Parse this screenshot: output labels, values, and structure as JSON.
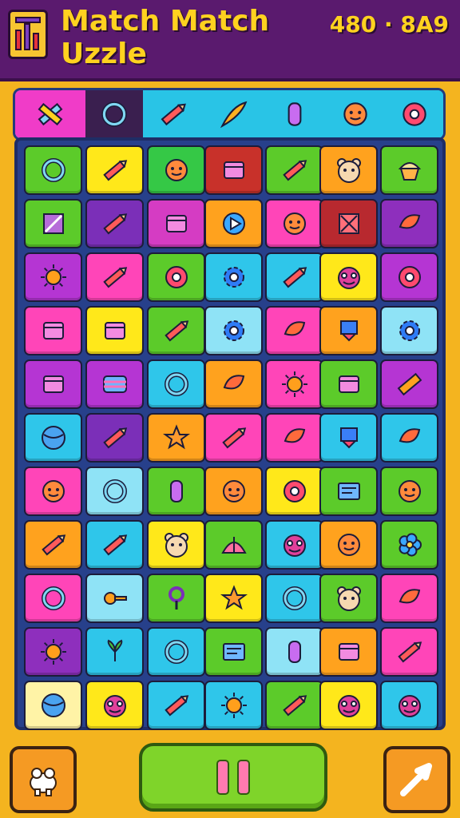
{
  "header": {
    "title": "Match Match Uzzle",
    "score_text": "480 · 8A9",
    "colors": {
      "bar": "#5a1a6e",
      "title": "#ffd21f"
    }
  },
  "toolbar": {
    "slots": [
      {
        "icon": "tools-icon",
        "bg": "#f03cc8"
      },
      {
        "icon": "ring-icon",
        "bg": "#3a1f4f"
      },
      {
        "icon": "pencil-icon",
        "bg": "#29c4e6"
      },
      {
        "icon": "feather-icon",
        "bg": "#29c4e6"
      },
      {
        "icon": "capsule-icon",
        "bg": "#29c4e6"
      },
      {
        "icon": "face-icon",
        "bg": "#29c4e6"
      },
      {
        "icon": "donut-icon",
        "bg": "#29c4e6"
      }
    ]
  },
  "board": {
    "rows": [
      [
        "#5ccb2a",
        "#ffe81a",
        "#35c846",
        "#c8312a",
        "#5ccb2a",
        "#ffa21e",
        "#5ccb2a"
      ],
      [
        "#5ccb2a",
        "#7b2fb8",
        "#d53cc3",
        "#ffa21e",
        "#ff45b8",
        "#b8292f",
        "#8e2fbd"
      ],
      [
        "#b535d3",
        "#ff45b8",
        "#5ccb2a",
        "#2fc6ea",
        "#2fc6ea",
        "#ffe81a",
        "#b535d3"
      ],
      [
        "#ff45b8",
        "#ffe81a",
        "#5ccb2a",
        "#8fe3f6",
        "#ff45b8",
        "#ffa21e",
        "#8fe3f6"
      ],
      [
        "#b535d3",
        "#b535d3",
        "#2fc6ea",
        "#ffa21e",
        "#ff45b8",
        "#5ccb2a",
        "#b535d3"
      ],
      [
        "#2fc6ea",
        "#7b2fb8",
        "#ffa21e",
        "#ff45b8",
        "#ff45b8",
        "#2fc6ea",
        "#2fc6ea"
      ],
      [
        "#ff45b8",
        "#8fe3f6",
        "#5ccb2a",
        "#ffa21e",
        "#ffe81a",
        "#5ccb2a",
        "#5ccb2a"
      ],
      [
        "#ffa21e",
        "#2fc6ea",
        "#ffe81a",
        "#5ccb2a",
        "#2fc6ea",
        "#ffa21e",
        "#5ccb2a"
      ],
      [
        "#ff45b8",
        "#8fe3f6",
        "#5ccb2a",
        "#ffe81a",
        "#2fc6ea",
        "#5ccb2a",
        "#ff45b8"
      ],
      [
        "#8e2fbd",
        "#2fc6ea",
        "#2fc6ea",
        "#5ccb2a",
        "#8fe3f6",
        "#ffa21e",
        "#ff45b8"
      ],
      [
        "#fff3a6",
        "#ffe81a",
        "#2fc6ea",
        "#2fc6ea",
        "#5ccb2a",
        "#ffe81a",
        "#2fc6ea"
      ]
    ],
    "icons": [
      [
        "ring-icon",
        "pencil-icon",
        "face-icon",
        "box-icon",
        "pencil-icon",
        "bear-icon",
        "cupcake-icon"
      ],
      [
        "frame-icon",
        "pencil-icon",
        "box-icon",
        "play-icon",
        "face-icon",
        "cross-icon",
        "bird-icon"
      ],
      [
        "sun-icon",
        "pencil-icon",
        "donut-icon",
        "gears-icon",
        "pencil-icon",
        "monster-icon",
        "swirl-icon"
      ],
      [
        "box-icon",
        "box-icon",
        "pencil-icon",
        "gear-icon",
        "leaf-icon",
        "ribbon-icon",
        "gear-icon"
      ],
      [
        "box-icon",
        "stripes-icon",
        "ring-icon",
        "leaf-icon",
        "sun-icon",
        "crate-icon",
        "ruler-icon"
      ],
      [
        "ball-icon",
        "pencil-icon",
        "star-icon",
        "pencil-icon",
        "leaf-icon",
        "flag-icon",
        "bird-icon"
      ],
      [
        "face-icon",
        "ring-icon",
        "capsule-icon",
        "face-icon",
        "donut-icon",
        "screen-icon",
        "face-icon"
      ],
      [
        "pencil-icon",
        "pencil-icon",
        "bear-icon",
        "tent-icon",
        "monster-icon",
        "face-icon",
        "flower-icon"
      ],
      [
        "ring-icon",
        "key-icon",
        "pin-icon",
        "star-icon",
        "ring-icon",
        "bear-icon",
        "leaf-icon"
      ],
      [
        "sun-icon",
        "plant-icon",
        "ring-icon",
        "screen-icon",
        "capsule-icon",
        "box-icon",
        "pencil-icon"
      ],
      [
        "ball-icon",
        "monster-icon",
        "pencil-icon",
        "sun-icon",
        "pencil-icon",
        "monster-icon",
        "monster-icon"
      ]
    ]
  },
  "footer": {
    "left_icon": "hippo-icon",
    "middle_icon": "pause-icon",
    "right_icon": "arrow-icon"
  }
}
